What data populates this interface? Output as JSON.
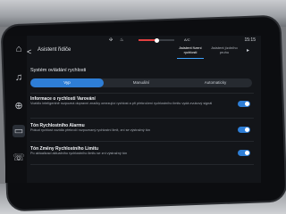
{
  "status": {
    "time": "15:15",
    "ac_label": "A/C"
  },
  "header": {
    "back_label": "<",
    "title": "Asistent řidiče"
  },
  "tabs": [
    {
      "label": "Asistent řízení rychlosti",
      "active": true
    },
    {
      "label": "Asistent jízdního pruhu",
      "active": false
    }
  ],
  "speed_section": {
    "title": "Systém ovládání rychlosti",
    "options": [
      "Vyp",
      "Manuální",
      "Automaticky"
    ],
    "selected": "Vyp",
    "selected_color": "#2e7ed6"
  },
  "rows": [
    {
      "title": "Informace o rychlosti Varování",
      "description": "Vozidlo inteligentně rozpozná dopravní značky omezující rychlost a při překročení rychlostního limitu vydá zvukový signál",
      "enabled": true
    },
    {
      "title": "Tón Rychlostního Alarmu",
      "description": "Pokud rychlost vozidla překročí rozpoznaný rychlostní limit, zní se výstražný tón",
      "enabled": true
    },
    {
      "title": "Tón Změny Rychlostního Limitu",
      "description": "Po aktualizaci aktuálního rychlostního limitu se zní výstražný tón",
      "enabled": true
    }
  ],
  "rail_icons": [
    "home-icon",
    "music-note-icon",
    "driver-assist-icon",
    "car-icon",
    "phone-icon"
  ],
  "toggle_color": "#2e7ed6"
}
